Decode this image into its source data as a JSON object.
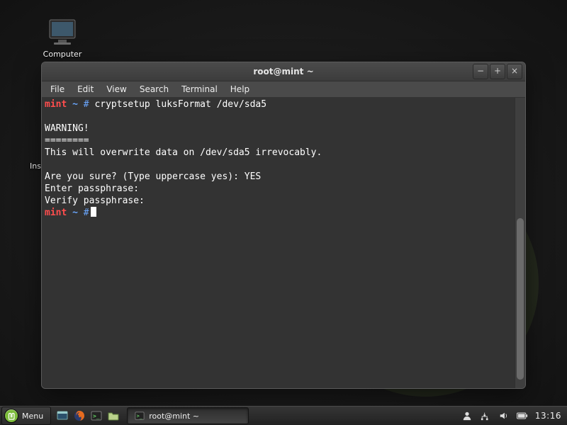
{
  "desktop": {
    "icons": {
      "computer_label": "Computer",
      "install_partial_label": "Insta"
    }
  },
  "window": {
    "title": "root@mint ~",
    "controls": {
      "minimize": "−",
      "maximize": "+",
      "close": "×"
    },
    "menu": {
      "file": "File",
      "edit": "Edit",
      "view": "View",
      "search": "Search",
      "terminal": "Terminal",
      "help": "Help"
    }
  },
  "terminal": {
    "prompt_host": "mint",
    "prompt_path": "~",
    "prompt_symbol": "#",
    "command1": "cryptsetup luksFormat /dev/sda5",
    "blank1": "",
    "warning_title": "WARNING!",
    "warning_rule": "========",
    "warning_body": "This will overwrite data on /dev/sda5 irrevocably.",
    "blank2": "",
    "confirm_line": "Are you sure? (Type uppercase yes): YES",
    "enter_pass": "Enter passphrase:",
    "verify_pass": "Verify passphrase:"
  },
  "taskbar": {
    "menu_label": "Menu",
    "task_label": "root@mint ~",
    "clock": "13:16"
  }
}
